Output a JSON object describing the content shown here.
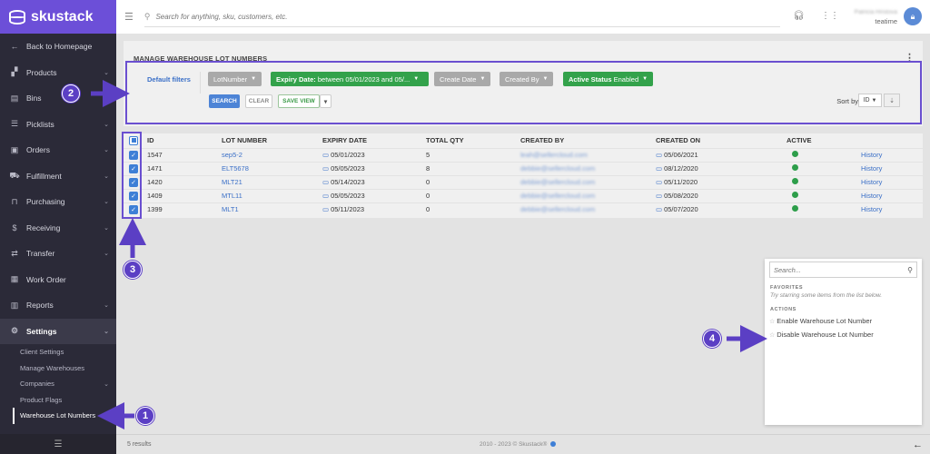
{
  "app": {
    "name": "skustack"
  },
  "topbar": {
    "search_placeholder": "Search for anything, sku, customers, etc.",
    "user_name": "Patricia Hristova",
    "user_org": "teatime"
  },
  "sidebar": {
    "items": [
      {
        "label": "Back to Homepage",
        "icon": "arrow-left-icon"
      },
      {
        "label": "Products",
        "icon": "products-icon"
      },
      {
        "label": "Bins",
        "icon": "bins-icon"
      },
      {
        "label": "Picklists",
        "icon": "list-icon"
      },
      {
        "label": "Orders",
        "icon": "clipboard-icon"
      },
      {
        "label": "Fulfillment",
        "icon": "truck-icon"
      },
      {
        "label": "Purchasing",
        "icon": "bag-icon"
      },
      {
        "label": "Receiving",
        "icon": "dollar-icon"
      },
      {
        "label": "Transfer",
        "icon": "transfer-icon"
      },
      {
        "label": "Work Order",
        "icon": "workorder-icon"
      },
      {
        "label": "Reports",
        "icon": "chart-icon"
      },
      {
        "label": "Settings",
        "icon": "gear-icon"
      }
    ],
    "sub_items": [
      {
        "label": "Client Settings"
      },
      {
        "label": "Manage Warehouses"
      },
      {
        "label": "Companies"
      },
      {
        "label": "Product Flags"
      },
      {
        "label": "Warehouse Lot Numbers"
      }
    ]
  },
  "page": {
    "title": "MANAGE WAREHOUSE LOT NUMBERS",
    "default_filters": "Default filters",
    "filters": {
      "lot_number": "LotNumber",
      "expiry_label": "Expiry Date:",
      "expiry_value": "between 05/01/2023 and 05/...",
      "create_date": "Create Date",
      "created_by": "Created By",
      "active_label": "Active Status",
      "active_value": "Enabled"
    },
    "buttons": {
      "search": "SEARCH",
      "clear": "CLEAR",
      "save_view": "SAVE VIEW"
    },
    "sort_by": "Sort by",
    "sort_value": "ID"
  },
  "table": {
    "headers": [
      "ID",
      "LOT NUMBER",
      "EXPIRY DATE",
      "TOTAL QTY",
      "CREATED BY",
      "CREATED ON",
      "ACTIVE"
    ],
    "history_label": "History",
    "rows": [
      {
        "id": "1547",
        "lot": "sep5-2",
        "expiry": "05/01/2023",
        "qty": "5",
        "created_by": "leah@sellercloud.com",
        "created_on": "05/06/2021"
      },
      {
        "id": "1471",
        "lot": "ELT5678",
        "expiry": "05/05/2023",
        "qty": "8",
        "created_by": "debbie@sellercloud.com",
        "created_on": "08/12/2020"
      },
      {
        "id": "1420",
        "lot": "MLT21",
        "expiry": "05/14/2023",
        "qty": "0",
        "created_by": "debbie@sellercloud.com",
        "created_on": "05/11/2020"
      },
      {
        "id": "1409",
        "lot": "MTL11",
        "expiry": "05/05/2023",
        "qty": "0",
        "created_by": "debbie@sellercloud.com",
        "created_on": "05/08/2020"
      },
      {
        "id": "1399",
        "lot": "MLT1",
        "expiry": "05/11/2023",
        "qty": "0",
        "created_by": "debbie@sellercloud.com",
        "created_on": "05/07/2020"
      }
    ]
  },
  "footer": {
    "results": "5 results",
    "copyright": "2010 - 2023 © Skustack®"
  },
  "palette": {
    "placeholder": "Search...",
    "favorites_title": "FAVORITES",
    "favorites_note": "Try starring some items from the list below.",
    "actions_title": "ACTIONS",
    "actions": [
      "Enable Warehouse Lot Number",
      "Disable Warehouse Lot Number"
    ]
  },
  "annotations": [
    "1",
    "2",
    "3",
    "4"
  ],
  "colors": {
    "accent": "#6c4fd8",
    "annotation": "#5b3fc4",
    "link": "#3a6fc7",
    "success": "#33a24b"
  }
}
